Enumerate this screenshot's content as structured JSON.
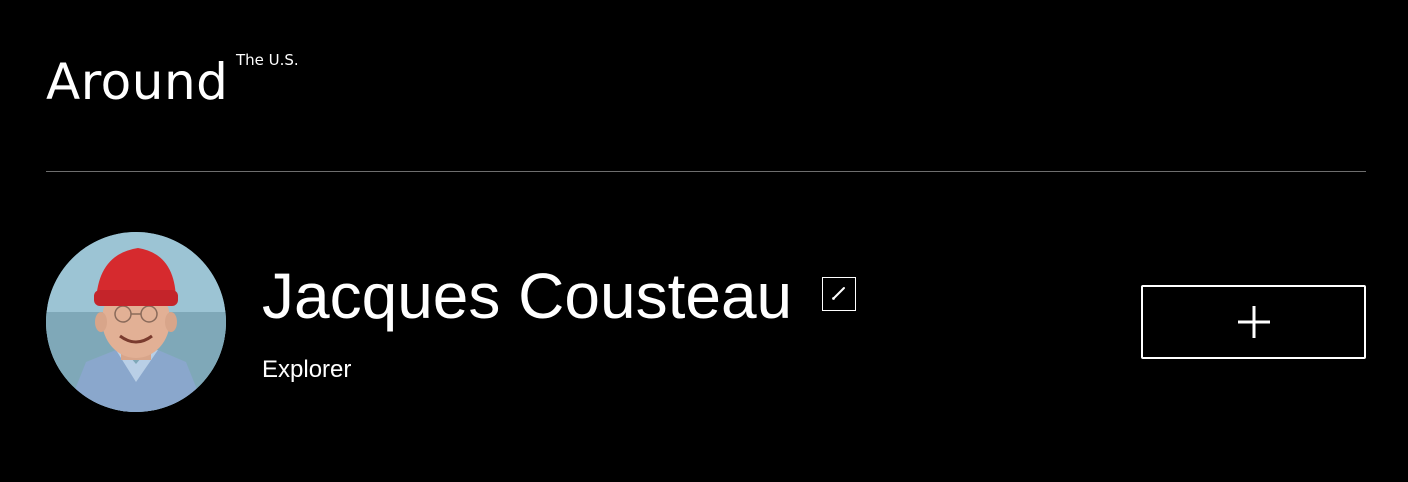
{
  "header": {
    "logo_main": "Around",
    "logo_sup": "The U.S."
  },
  "profile": {
    "name": "Jacques Cousteau",
    "role": "Explorer",
    "avatar_icon": "portrait-photo",
    "edit_icon": "pencil-icon",
    "add_icon": "plus-icon"
  },
  "colors": {
    "background": "#000000",
    "text": "#ffffff",
    "divider": "#6e6e6e",
    "hat": "#d62a2e"
  }
}
